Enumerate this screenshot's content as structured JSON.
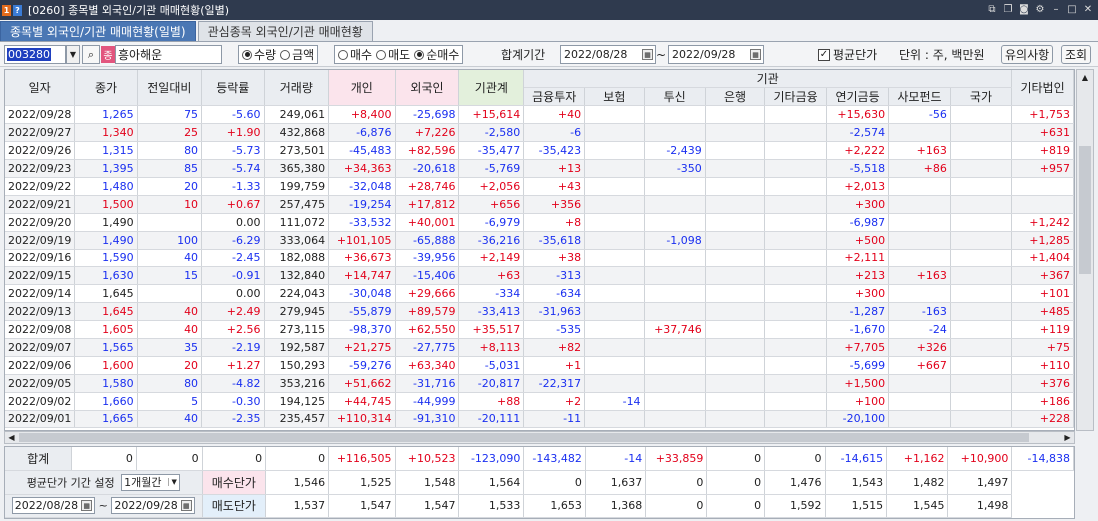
{
  "titlebar": {
    "screen_no": "[0260]",
    "title": "종목별 외국인/기관 매매현황(일별)"
  },
  "tabs": [
    {
      "label": "종목별 외국인/기관 매매현황(일별)"
    },
    {
      "label": "관심종목 외국인/기관 매매현황"
    }
  ],
  "toolbar": {
    "code": "003280",
    "badge": "종",
    "stock_name": "흥아해운",
    "radio1": [
      {
        "label": "수량",
        "on": true
      },
      {
        "label": "금액",
        "on": false
      }
    ],
    "radio2": [
      {
        "label": "매수",
        "on": false
      },
      {
        "label": "매도",
        "on": false
      },
      {
        "label": "순매수",
        "on": true
      }
    ],
    "period_label": "합계기간",
    "date_from": "2022/08/28",
    "tilde": "~",
    "date_to": "2022/09/28",
    "avg_price_label": "평균단가",
    "unit_label": "단위 : 주, 백만원",
    "notice_button": "유의사항",
    "query_button": "조회"
  },
  "columns": {
    "date": "일자",
    "close": "종가",
    "change": "전일대비",
    "rate": "등락률",
    "volume": "거래량",
    "individual": "개인",
    "foreign": "외국인",
    "inst_total": "기관계",
    "inst_group": "기관",
    "finance": "금융투자",
    "insurance": "보험",
    "trust": "투신",
    "bank": "은행",
    "other_fin": "기타금융",
    "pension": "연기금등",
    "private_fund": "사모펀드",
    "nation": "국가",
    "other_corp": "기타법인"
  },
  "rows": [
    {
      "date": "2022/09/28",
      "close": "1,265",
      "change": "75",
      "rate": "-5.60",
      "volume": "249,061",
      "ind": "+8,400",
      "frg": "-25,698",
      "inst": "+15,614",
      "fin": "+40",
      "ins": "",
      "trust": "",
      "bank": "",
      "ofin": "",
      "pen": "+15,630",
      "pf": "-56",
      "nat": "",
      "ocorp": "+1,753",
      "dir": "down"
    },
    {
      "date": "2022/09/27",
      "close": "1,340",
      "change": "25",
      "rate": "+1.90",
      "volume": "432,868",
      "ind": "-6,876",
      "frg": "+7,226",
      "inst": "-2,580",
      "fin": "-6",
      "ins": "",
      "trust": "",
      "bank": "",
      "ofin": "",
      "pen": "-2,574",
      "pf": "",
      "nat": "",
      "ocorp": "+631",
      "dir": "up"
    },
    {
      "date": "2022/09/26",
      "close": "1,315",
      "change": "80",
      "rate": "-5.73",
      "volume": "273,501",
      "ind": "-45,483",
      "frg": "+82,596",
      "inst": "-35,477",
      "fin": "-35,423",
      "ins": "",
      "trust": "-2,439",
      "bank": "",
      "ofin": "",
      "pen": "+2,222",
      "pf": "+163",
      "nat": "",
      "ocorp": "+819",
      "dir": "down"
    },
    {
      "date": "2022/09/23",
      "close": "1,395",
      "change": "85",
      "rate": "-5.74",
      "volume": "365,380",
      "ind": "+34,363",
      "frg": "-20,618",
      "inst": "-5,769",
      "fin": "+13",
      "ins": "",
      "trust": "-350",
      "bank": "",
      "ofin": "",
      "pen": "-5,518",
      "pf": "+86",
      "nat": "",
      "ocorp": "+957",
      "dir": "down"
    },
    {
      "date": "2022/09/22",
      "close": "1,480",
      "change": "20",
      "rate": "-1.33",
      "volume": "199,759",
      "ind": "-32,048",
      "frg": "+28,746",
      "inst": "+2,056",
      "fin": "+43",
      "ins": "",
      "trust": "",
      "bank": "",
      "ofin": "",
      "pen": "+2,013",
      "pf": "",
      "nat": "",
      "ocorp": "",
      "dir": "down"
    },
    {
      "date": "2022/09/21",
      "close": "1,500",
      "change": "10",
      "rate": "+0.67",
      "volume": "257,475",
      "ind": "-19,254",
      "frg": "+17,812",
      "inst": "+656",
      "fin": "+356",
      "ins": "",
      "trust": "",
      "bank": "",
      "ofin": "",
      "pen": "+300",
      "pf": "",
      "nat": "",
      "ocorp": "",
      "dir": "up"
    },
    {
      "date": "2022/09/20",
      "close": "1,490",
      "change": "",
      "rate": "0.00",
      "volume": "111,072",
      "ind": "-33,532",
      "frg": "+40,001",
      "inst": "-6,979",
      "fin": "+8",
      "ins": "",
      "trust": "",
      "bank": "",
      "ofin": "",
      "pen": "-6,987",
      "pf": "",
      "nat": "",
      "ocorp": "+1,242",
      "dir": "flat"
    },
    {
      "date": "2022/09/19",
      "close": "1,490",
      "change": "100",
      "rate": "-6.29",
      "volume": "333,064",
      "ind": "+101,105",
      "frg": "-65,888",
      "inst": "-36,216",
      "fin": "-35,618",
      "ins": "",
      "trust": "-1,098",
      "bank": "",
      "ofin": "",
      "pen": "+500",
      "pf": "",
      "nat": "",
      "ocorp": "+1,285",
      "dir": "down"
    },
    {
      "date": "2022/09/16",
      "close": "1,590",
      "change": "40",
      "rate": "-2.45",
      "volume": "182,088",
      "ind": "+36,673",
      "frg": "-39,956",
      "inst": "+2,149",
      "fin": "+38",
      "ins": "",
      "trust": "",
      "bank": "",
      "ofin": "",
      "pen": "+2,111",
      "pf": "",
      "nat": "",
      "ocorp": "+1,404",
      "dir": "down"
    },
    {
      "date": "2022/09/15",
      "close": "1,630",
      "change": "15",
      "rate": "-0.91",
      "volume": "132,840",
      "ind": "+14,747",
      "frg": "-15,406",
      "inst": "+63",
      "fin": "-313",
      "ins": "",
      "trust": "",
      "bank": "",
      "ofin": "",
      "pen": "+213",
      "pf": "+163",
      "nat": "",
      "ocorp": "+367",
      "dir": "down"
    },
    {
      "date": "2022/09/14",
      "close": "1,645",
      "change": "",
      "rate": "0.00",
      "volume": "224,043",
      "ind": "-30,048",
      "frg": "+29,666",
      "inst": "-334",
      "fin": "-634",
      "ins": "",
      "trust": "",
      "bank": "",
      "ofin": "",
      "pen": "+300",
      "pf": "",
      "nat": "",
      "ocorp": "+101",
      "dir": "flat"
    },
    {
      "date": "2022/09/13",
      "close": "1,645",
      "change": "40",
      "rate": "+2.49",
      "volume": "279,945",
      "ind": "-55,879",
      "frg": "+89,579",
      "inst": "-33,413",
      "fin": "-31,963",
      "ins": "",
      "trust": "",
      "bank": "",
      "ofin": "",
      "pen": "-1,287",
      "pf": "-163",
      "nat": "",
      "ocorp": "+485",
      "dir": "up"
    },
    {
      "date": "2022/09/08",
      "close": "1,605",
      "change": "40",
      "rate": "+2.56",
      "volume": "273,115",
      "ind": "-98,370",
      "frg": "+62,550",
      "inst": "+35,517",
      "fin": "-535",
      "ins": "",
      "trust": "+37,746",
      "bank": "",
      "ofin": "",
      "pen": "-1,670",
      "pf": "-24",
      "nat": "",
      "ocorp": "+119",
      "dir": "up"
    },
    {
      "date": "2022/09/07",
      "close": "1,565",
      "change": "35",
      "rate": "-2.19",
      "volume": "192,587",
      "ind": "+21,275",
      "frg": "-27,775",
      "inst": "+8,113",
      "fin": "+82",
      "ins": "",
      "trust": "",
      "bank": "",
      "ofin": "",
      "pen": "+7,705",
      "pf": "+326",
      "nat": "",
      "ocorp": "+75",
      "dir": "down"
    },
    {
      "date": "2022/09/06",
      "close": "1,600",
      "change": "20",
      "rate": "+1.27",
      "volume": "150,293",
      "ind": "-59,276",
      "frg": "+63,340",
      "inst": "-5,031",
      "fin": "+1",
      "ins": "",
      "trust": "",
      "bank": "",
      "ofin": "",
      "pen": "-5,699",
      "pf": "+667",
      "nat": "",
      "ocorp": "+110",
      "dir": "up"
    },
    {
      "date": "2022/09/05",
      "close": "1,580",
      "change": "80",
      "rate": "-4.82",
      "volume": "353,216",
      "ind": "+51,662",
      "frg": "-31,716",
      "inst": "-20,817",
      "fin": "-22,317",
      "ins": "",
      "trust": "",
      "bank": "",
      "ofin": "",
      "pen": "+1,500",
      "pf": "",
      "nat": "",
      "ocorp": "+376",
      "dir": "down"
    },
    {
      "date": "2022/09/02",
      "close": "1,660",
      "change": "5",
      "rate": "-0.30",
      "volume": "194,125",
      "ind": "+44,745",
      "frg": "-44,999",
      "inst": "+88",
      "fin": "+2",
      "ins": "-14",
      "trust": "",
      "bank": "",
      "ofin": "",
      "pen": "+100",
      "pf": "",
      "nat": "",
      "ocorp": "+186",
      "dir": "down"
    },
    {
      "date": "2022/09/01",
      "close": "1,665",
      "change": "40",
      "rate": "-2.35",
      "volume": "235,457",
      "ind": "+110,314",
      "frg": "-91,310",
      "inst": "-20,111",
      "fin": "-11",
      "ins": "",
      "trust": "",
      "bank": "",
      "ofin": "",
      "pen": "-20,100",
      "pf": "",
      "nat": "",
      "ocorp": "+228",
      "dir": "down"
    }
  ],
  "summary": {
    "total_label": "합계",
    "total": [
      "0",
      "0",
      "0",
      "0",
      "+116,505",
      "+10,523",
      "-123,090",
      "-143,482",
      "-14",
      "+33,859",
      "0",
      "0",
      "-14,615",
      "+1,162",
      "+10,900",
      "-14,838"
    ],
    "avg_period_label": "평균단가 기간 설정",
    "avg_period_value": "1개월간",
    "buy_label": "매수단가",
    "buy": [
      "1,546",
      "1,525",
      "1,548",
      "1,564",
      "0",
      "1,637",
      "0",
      "0",
      "1,476",
      "1,543",
      "1,482",
      "1,497"
    ],
    "avg_from": "2022/08/28",
    "avg_tilde": "~",
    "avg_to": "2022/09/28",
    "sell_label": "매도단가",
    "sell": [
      "1,537",
      "1,547",
      "1,547",
      "1,533",
      "1,653",
      "1,368",
      "0",
      "0",
      "1,592",
      "1,515",
      "1,545",
      "1,498"
    ]
  },
  "colors": {
    "up": "#e2001a",
    "down": "#1a2ff0",
    "tab_active": "#4a77b4",
    "titlebar": "#2f3a4e"
  }
}
